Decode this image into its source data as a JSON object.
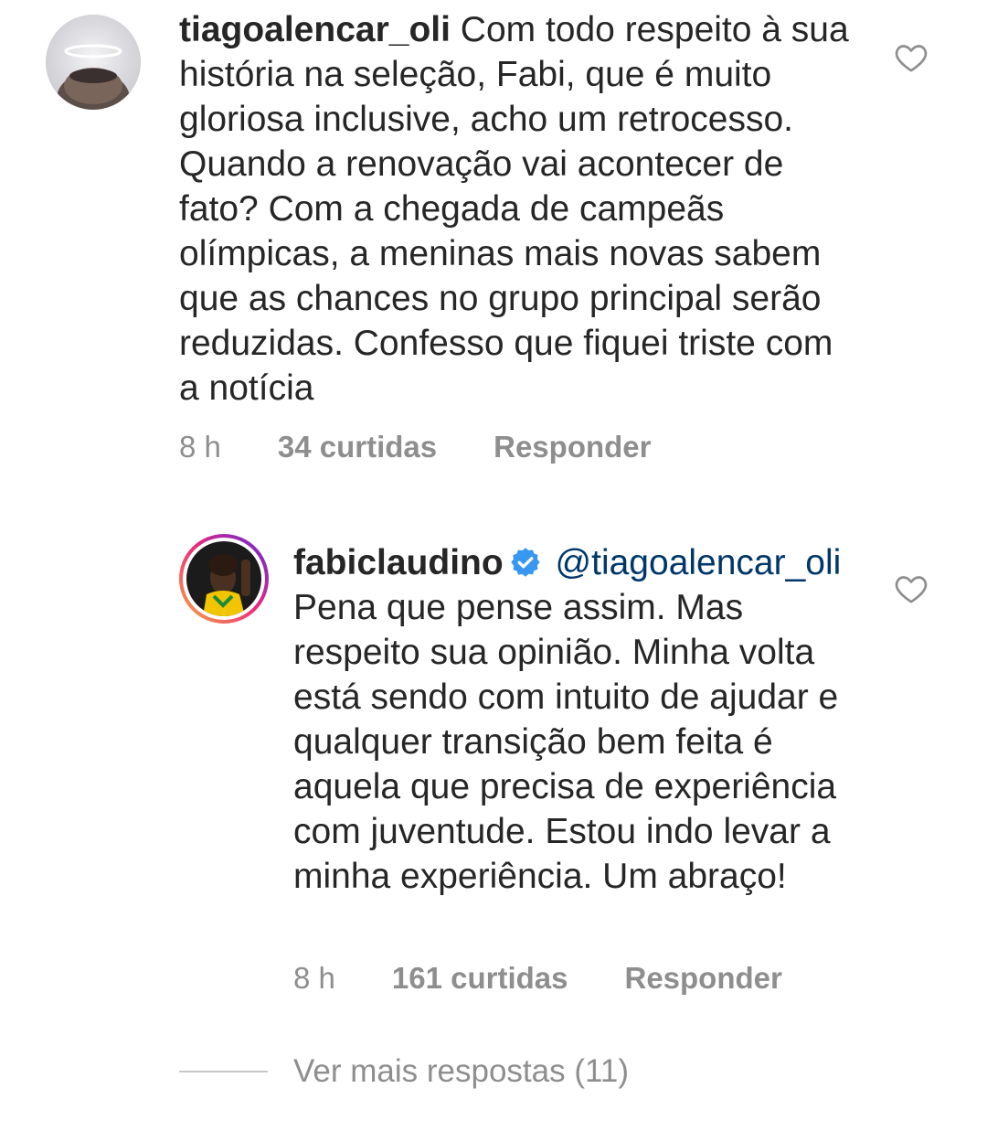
{
  "comments": [
    {
      "username": "tiagoalencar_oli",
      "text": "Com todo respeito à  sua história na seleção, Fabi, que é  muito gloriosa inclusive, acho um retrocesso. Quando a renovação vai acontecer de fato? Com a chegada de campeãs olímpicas, a meninas mais novas sabem que as chances no grupo principal serão reduzidas. Confesso que fiquei triste com a notícia",
      "time": "8 h",
      "likes": "34 curtidas",
      "reply_label": "Responder",
      "avatar_icon": "person-with-halo-avatar",
      "like_icon": "heart-outline-icon"
    },
    {
      "username": "fabiclaudino",
      "verified_icon": "verified-badge-icon",
      "mention": "@tiagoalencar_oli",
      "text": "Pena que pense assim. Mas respeito sua opinião. Minha volta está sendo com intuito de ajudar e qualquer transição bem feita é aquela que precisa de experiência com juventude. Estou indo levar a minha experiência. Um abraço!",
      "time": "8 h",
      "likes": "161 curtidas",
      "reply_label": "Responder",
      "avatar_icon": "volleyball-player-avatar",
      "like_icon": "heart-outline-icon"
    }
  ],
  "more_replies_label": "Ver mais respostas (11)",
  "colors": {
    "text": "#262626",
    "secondary": "#8e8e8e",
    "mention": "#00376b",
    "verified": "#3897f0"
  }
}
